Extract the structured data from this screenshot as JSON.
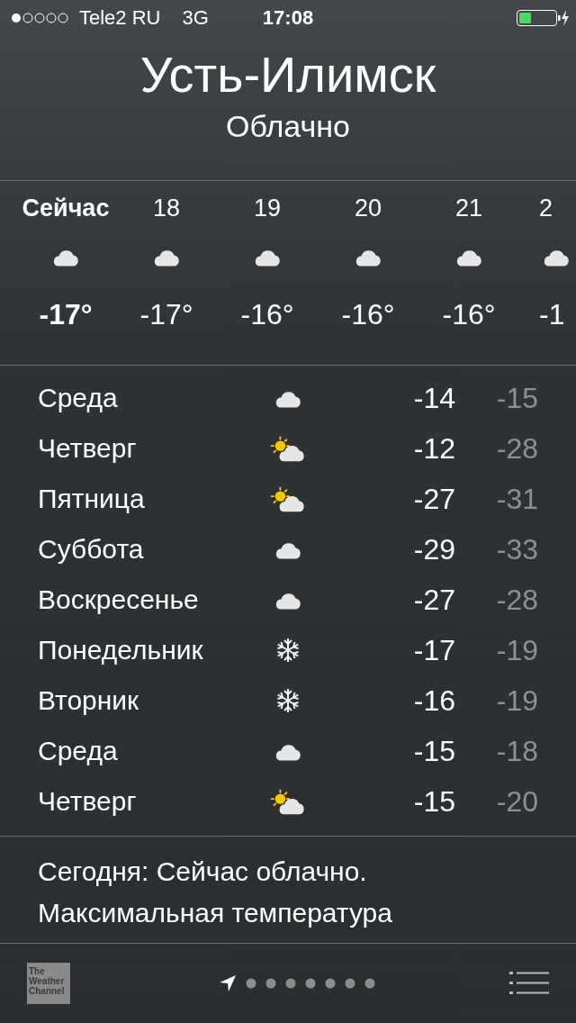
{
  "status_bar": {
    "carrier": "Tele2 RU",
    "network": "3G",
    "time": "17:08"
  },
  "header": {
    "city": "Усть-Илимск",
    "condition": "Облачно"
  },
  "hourly": [
    {
      "label": "Сейчас",
      "kind": "cloud",
      "temp": "-17°",
      "current": true
    },
    {
      "label": "18",
      "kind": "cloud",
      "temp": "-17°",
      "current": false
    },
    {
      "label": "19",
      "kind": "cloud",
      "temp": "-16°",
      "current": false
    },
    {
      "label": "20",
      "kind": "cloud",
      "temp": "-16°",
      "current": false
    },
    {
      "label": "21",
      "kind": "cloud",
      "temp": "-16°",
      "current": false
    },
    {
      "label": "2",
      "kind": "cloud",
      "temp": "-1",
      "current": false
    }
  ],
  "daily": [
    {
      "day": "Среда",
      "kind": "cloud",
      "high": "-14",
      "low": "-15"
    },
    {
      "day": "Четверг",
      "kind": "sun-cloud",
      "high": "-12",
      "low": "-28"
    },
    {
      "day": "Пятница",
      "kind": "sun-cloud",
      "high": "-27",
      "low": "-31"
    },
    {
      "day": "Суббота",
      "kind": "cloud",
      "high": "-29",
      "low": "-33"
    },
    {
      "day": "Воскресенье",
      "kind": "cloud",
      "high": "-27",
      "low": "-28"
    },
    {
      "day": "Понедельник",
      "kind": "snow",
      "high": "-17",
      "low": "-19"
    },
    {
      "day": "Вторник",
      "kind": "snow",
      "high": "-16",
      "low": "-19"
    },
    {
      "day": "Среда",
      "kind": "cloud",
      "high": "-15",
      "low": "-18"
    },
    {
      "day": "Четверг",
      "kind": "sun-cloud",
      "high": "-15",
      "low": "-20"
    }
  ],
  "summary": "Сегодня: Сейчас облачно. Максимальная температура",
  "bottom_bar": {
    "logo": "The Weather Channel",
    "pages": [
      {
        "kind": "location",
        "selected": true
      },
      {
        "kind": "dot",
        "selected": false
      },
      {
        "kind": "dot",
        "selected": false
      },
      {
        "kind": "dot",
        "selected": false
      },
      {
        "kind": "dot",
        "selected": false
      },
      {
        "kind": "dot",
        "selected": false
      },
      {
        "kind": "dot",
        "selected": false
      },
      {
        "kind": "dot",
        "selected": false
      }
    ]
  }
}
